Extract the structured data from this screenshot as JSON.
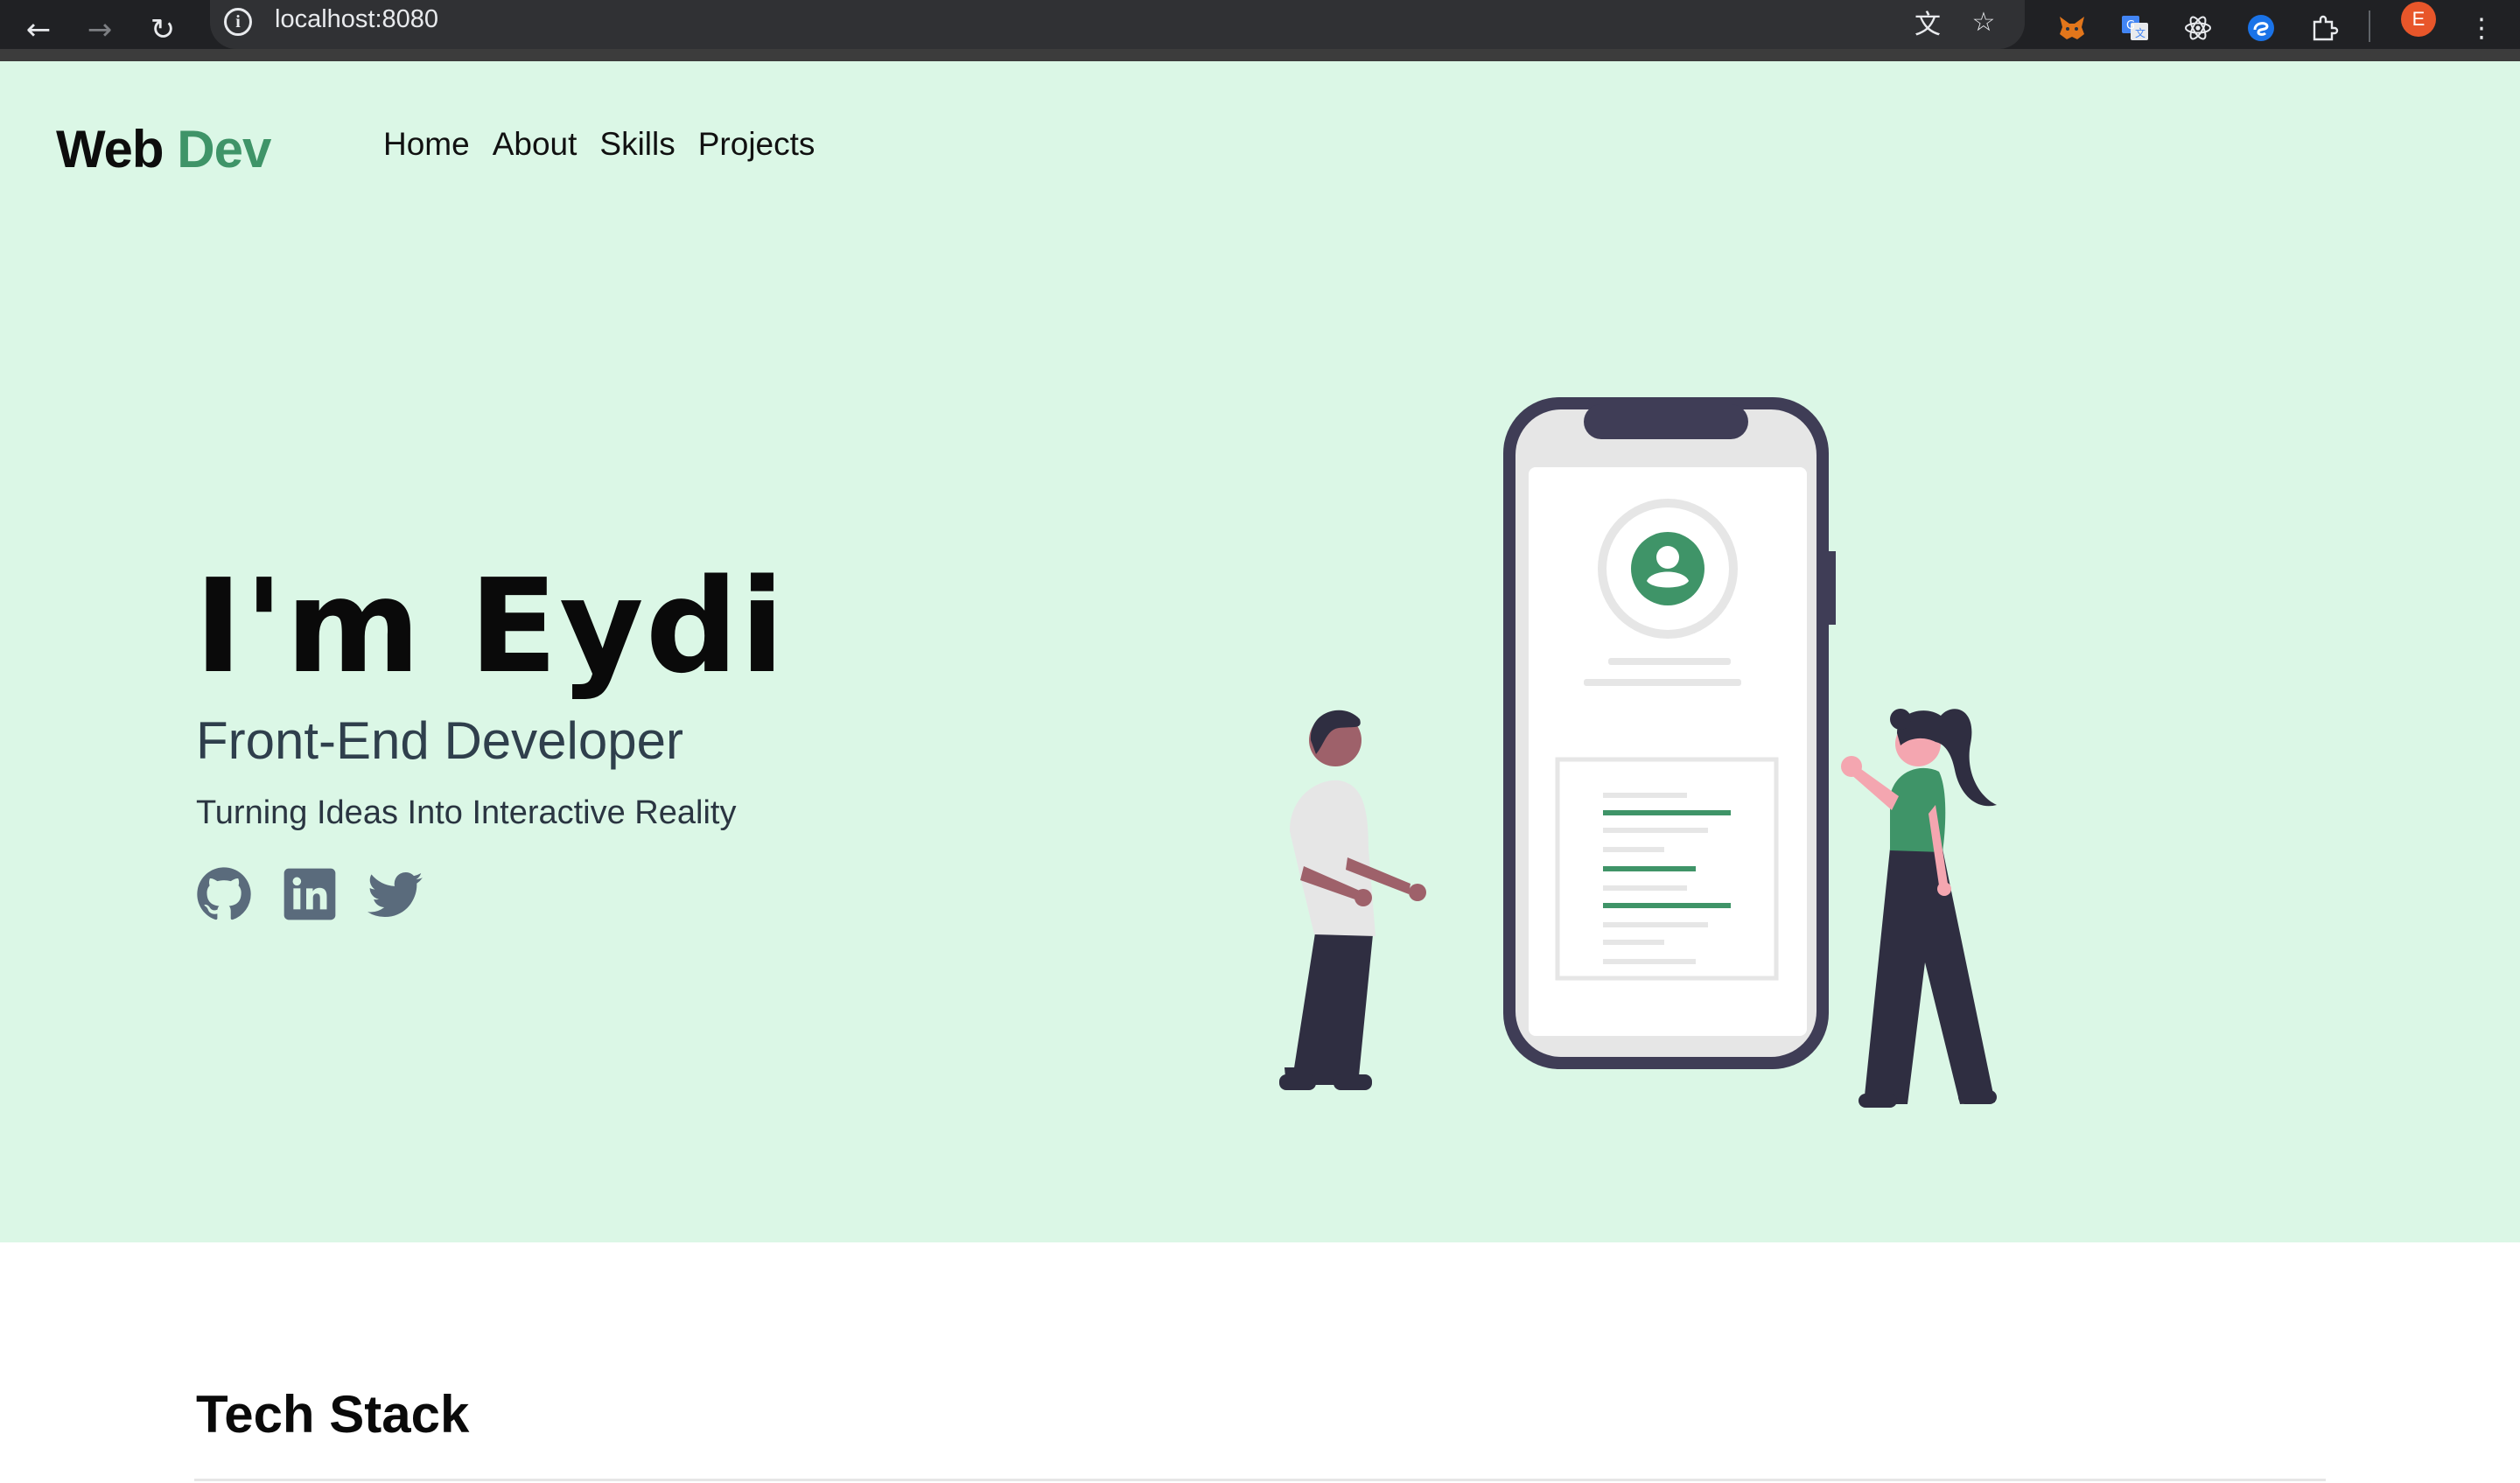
{
  "browser": {
    "url": "localhost:8080",
    "profile_initial": "E"
  },
  "header": {
    "logo_part1": "Web",
    "logo_part2": "Dev",
    "nav": [
      "Home",
      "About",
      "Skills",
      "Projects"
    ]
  },
  "hero": {
    "title": "I'm Eydi",
    "role": "Front-End Developer",
    "tagline": "Turning Ideas Into Interactive Reality",
    "socials": [
      "github-icon",
      "linkedin-icon",
      "twitter-icon"
    ]
  },
  "tech_stack": {
    "title": "Tech Stack"
  },
  "colors": {
    "hero_bg": "#dbf7e6",
    "accent": "#3f9468",
    "icon_gray": "#5a6b7c",
    "chrome_bg": "#202124"
  }
}
